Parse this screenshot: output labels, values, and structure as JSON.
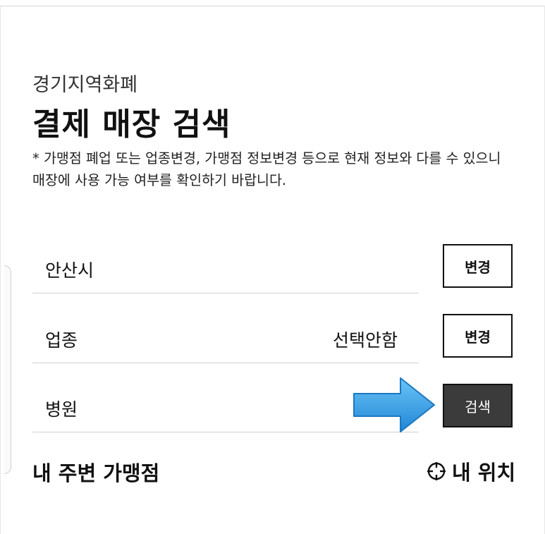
{
  "header": {
    "subtitle": "경기지역화폐",
    "title": "결제 매장 검색",
    "notice": "* 가맹점 폐업 또는 업종변경, 가맹점 정보변경 등으로 현재 정보와 다를 수 있으니 매장에 사용 가능 여부를 확인하기 바랍니다."
  },
  "filters": {
    "region": {
      "label": "안산시",
      "button_label": "변경"
    },
    "business_type": {
      "label": "업종",
      "value": "선택안함",
      "button_label": "변경"
    },
    "keyword": {
      "value": "병원",
      "button_label": "검색"
    }
  },
  "nearby": {
    "title": "내 주변 가맹점",
    "location_label": "내 위치"
  },
  "icons": {
    "location": "crosshair-icon",
    "annotation": "arrow-right-icon"
  },
  "colors": {
    "accent_arrow": "#3aa6ea",
    "search_button": "#3b3b3b"
  }
}
